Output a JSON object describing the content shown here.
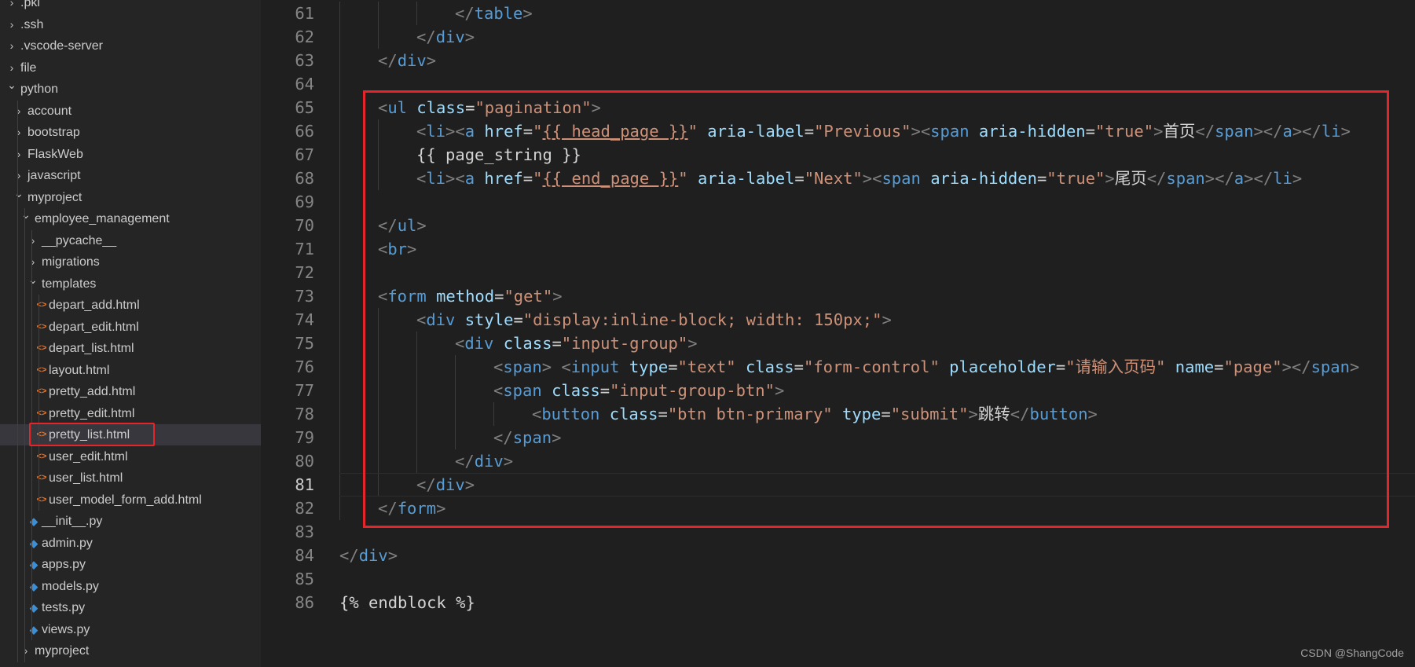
{
  "sidebar": {
    "items": [
      {
        "label": ".pki",
        "type": "folder",
        "state": "collapsed",
        "depth": 0
      },
      {
        "label": ".ssh",
        "type": "folder",
        "state": "collapsed",
        "depth": 0
      },
      {
        "label": ".vscode-server",
        "type": "folder",
        "state": "collapsed",
        "depth": 0
      },
      {
        "label": "file",
        "type": "folder",
        "state": "collapsed",
        "depth": 0
      },
      {
        "label": "python",
        "type": "folder",
        "state": "expanded",
        "depth": 0
      },
      {
        "label": "account",
        "type": "folder",
        "state": "collapsed",
        "depth": 1
      },
      {
        "label": "bootstrap",
        "type": "folder",
        "state": "collapsed",
        "depth": 1
      },
      {
        "label": "FlaskWeb",
        "type": "folder",
        "state": "collapsed",
        "depth": 1
      },
      {
        "label": "javascript",
        "type": "folder",
        "state": "collapsed",
        "depth": 1
      },
      {
        "label": "myproject",
        "type": "folder",
        "state": "expanded",
        "depth": 1
      },
      {
        "label": "employee_management",
        "type": "folder",
        "state": "expanded",
        "depth": 2
      },
      {
        "label": "__pycache__",
        "type": "folder",
        "state": "collapsed",
        "depth": 3
      },
      {
        "label": "migrations",
        "type": "folder",
        "state": "collapsed",
        "depth": 3
      },
      {
        "label": "templates",
        "type": "folder",
        "state": "expanded",
        "depth": 3
      },
      {
        "label": "depart_add.html",
        "type": "html",
        "depth": 4
      },
      {
        "label": "depart_edit.html",
        "type": "html",
        "depth": 4
      },
      {
        "label": "depart_list.html",
        "type": "html",
        "depth": 4
      },
      {
        "label": "layout.html",
        "type": "html",
        "depth": 4
      },
      {
        "label": "pretty_add.html",
        "type": "html",
        "depth": 4
      },
      {
        "label": "pretty_edit.html",
        "type": "html",
        "depth": 4
      },
      {
        "label": "pretty_list.html",
        "type": "html",
        "depth": 4,
        "selected": true
      },
      {
        "label": "user_edit.html",
        "type": "html",
        "depth": 4
      },
      {
        "label": "user_list.html",
        "type": "html",
        "depth": 4
      },
      {
        "label": "user_model_form_add.html",
        "type": "html",
        "depth": 4
      },
      {
        "label": "__init__.py",
        "type": "py",
        "depth": 3
      },
      {
        "label": "admin.py",
        "type": "py",
        "depth": 3
      },
      {
        "label": "apps.py",
        "type": "py",
        "depth": 3
      },
      {
        "label": "models.py",
        "type": "py",
        "depth": 3
      },
      {
        "label": "tests.py",
        "type": "py",
        "depth": 3
      },
      {
        "label": "views.py",
        "type": "py",
        "depth": 3
      },
      {
        "label": "myproject",
        "type": "folder",
        "state": "collapsed",
        "depth": 2
      }
    ]
  },
  "editor": {
    "active_line": "81",
    "lines": [
      {
        "n": "61",
        "indent": 3,
        "tokens": [
          [
            "bk",
            "</"
          ],
          [
            "t",
            "table"
          ],
          [
            "bk",
            ">"
          ]
        ]
      },
      {
        "n": "62",
        "indent": 2,
        "tokens": [
          [
            "bk",
            "</"
          ],
          [
            "t",
            "div"
          ],
          [
            "bk",
            ">"
          ]
        ]
      },
      {
        "n": "63",
        "indent": 1,
        "tokens": [
          [
            "bk",
            "</"
          ],
          [
            "t",
            "div"
          ],
          [
            "bk",
            ">"
          ]
        ]
      },
      {
        "n": "64",
        "indent": 0,
        "tokens": []
      },
      {
        "n": "65",
        "indent": 1,
        "tokens": [
          [
            "bk",
            "<"
          ],
          [
            "t",
            "ul"
          ],
          [
            "tx",
            " "
          ],
          [
            "at",
            "class"
          ],
          [
            "tx",
            "="
          ],
          [
            "st",
            "\"pagination\""
          ],
          [
            "bk",
            ">"
          ]
        ]
      },
      {
        "n": "66",
        "indent": 2,
        "tokens": [
          [
            "bk",
            "<"
          ],
          [
            "t",
            "li"
          ],
          [
            "bk",
            "><"
          ],
          [
            "t",
            "a"
          ],
          [
            "tx",
            " "
          ],
          [
            "at",
            "href"
          ],
          [
            "tx",
            "="
          ],
          [
            "st",
            "\""
          ],
          [
            "st ul",
            "{{ head_page }}"
          ],
          [
            "st",
            "\""
          ],
          [
            "tx",
            " "
          ],
          [
            "at",
            "aria-label"
          ],
          [
            "tx",
            "="
          ],
          [
            "st",
            "\"Previous\""
          ],
          [
            "bk",
            "><"
          ],
          [
            "t",
            "span"
          ],
          [
            "tx",
            " "
          ],
          [
            "at",
            "aria-hidden"
          ],
          [
            "tx",
            "="
          ],
          [
            "st",
            "\"true\""
          ],
          [
            "bk",
            ">"
          ],
          [
            "tx",
            "首页"
          ],
          [
            "bk",
            "</"
          ],
          [
            "t",
            "span"
          ],
          [
            "bk",
            "></"
          ],
          [
            "t",
            "a"
          ],
          [
            "bk",
            "></"
          ],
          [
            "t",
            "li"
          ],
          [
            "bk",
            ">"
          ]
        ]
      },
      {
        "n": "67",
        "indent": 2,
        "tokens": [
          [
            "tx",
            "{{ page_string }}"
          ]
        ]
      },
      {
        "n": "68",
        "indent": 2,
        "tokens": [
          [
            "bk",
            "<"
          ],
          [
            "t",
            "li"
          ],
          [
            "bk",
            "><"
          ],
          [
            "t",
            "a"
          ],
          [
            "tx",
            " "
          ],
          [
            "at",
            "href"
          ],
          [
            "tx",
            "="
          ],
          [
            "st",
            "\""
          ],
          [
            "st ul",
            "{{ end_page }}"
          ],
          [
            "st",
            "\""
          ],
          [
            "tx",
            " "
          ],
          [
            "at",
            "aria-label"
          ],
          [
            "tx",
            "="
          ],
          [
            "st",
            "\"Next\""
          ],
          [
            "bk",
            "><"
          ],
          [
            "t",
            "span"
          ],
          [
            "tx",
            " "
          ],
          [
            "at",
            "aria-hidden"
          ],
          [
            "tx",
            "="
          ],
          [
            "st",
            "\"true\""
          ],
          [
            "bk",
            ">"
          ],
          [
            "tx",
            "尾页"
          ],
          [
            "bk",
            "</"
          ],
          [
            "t",
            "span"
          ],
          [
            "bk",
            "></"
          ],
          [
            "t",
            "a"
          ],
          [
            "bk",
            "></"
          ],
          [
            "t",
            "li"
          ],
          [
            "bk",
            ">"
          ]
        ]
      },
      {
        "n": "69",
        "indent": 0,
        "tokens": []
      },
      {
        "n": "70",
        "indent": 1,
        "tokens": [
          [
            "bk",
            "</"
          ],
          [
            "t",
            "ul"
          ],
          [
            "bk",
            ">"
          ]
        ]
      },
      {
        "n": "71",
        "indent": 1,
        "tokens": [
          [
            "bk",
            "<"
          ],
          [
            "t",
            "br"
          ],
          [
            "bk",
            ">"
          ]
        ]
      },
      {
        "n": "72",
        "indent": 0,
        "tokens": []
      },
      {
        "n": "73",
        "indent": 1,
        "tokens": [
          [
            "bk",
            "<"
          ],
          [
            "t",
            "form"
          ],
          [
            "tx",
            " "
          ],
          [
            "at",
            "method"
          ],
          [
            "tx",
            "="
          ],
          [
            "st",
            "\"get\""
          ],
          [
            "bk",
            ">"
          ]
        ]
      },
      {
        "n": "74",
        "indent": 2,
        "tokens": [
          [
            "bk",
            "<"
          ],
          [
            "t",
            "div"
          ],
          [
            "tx",
            " "
          ],
          [
            "at",
            "style"
          ],
          [
            "tx",
            "="
          ],
          [
            "st",
            "\"display:inline-block; width: 150px;\""
          ],
          [
            "bk",
            ">"
          ]
        ]
      },
      {
        "n": "75",
        "indent": 3,
        "tokens": [
          [
            "bk",
            "<"
          ],
          [
            "t",
            "div"
          ],
          [
            "tx",
            " "
          ],
          [
            "at",
            "class"
          ],
          [
            "tx",
            "="
          ],
          [
            "st",
            "\"input-group\""
          ],
          [
            "bk",
            ">"
          ]
        ]
      },
      {
        "n": "76",
        "indent": 4,
        "tokens": [
          [
            "bk",
            "<"
          ],
          [
            "t",
            "span"
          ],
          [
            "bk",
            ">"
          ],
          [
            "tx",
            " "
          ],
          [
            "bk",
            "<"
          ],
          [
            "t",
            "input"
          ],
          [
            "tx",
            " "
          ],
          [
            "at",
            "type"
          ],
          [
            "tx",
            "="
          ],
          [
            "st",
            "\"text\""
          ],
          [
            "tx",
            " "
          ],
          [
            "at",
            "class"
          ],
          [
            "tx",
            "="
          ],
          [
            "st",
            "\"form-control\""
          ],
          [
            "tx",
            " "
          ],
          [
            "at",
            "placeholder"
          ],
          [
            "tx",
            "="
          ],
          [
            "st",
            "\"请输入页码\""
          ],
          [
            "tx",
            " "
          ],
          [
            "at",
            "name"
          ],
          [
            "tx",
            "="
          ],
          [
            "st",
            "\"page\""
          ],
          [
            "bk",
            "></"
          ],
          [
            "t",
            "span"
          ],
          [
            "bk",
            ">"
          ]
        ]
      },
      {
        "n": "77",
        "indent": 4,
        "tokens": [
          [
            "bk",
            "<"
          ],
          [
            "t",
            "span"
          ],
          [
            "tx",
            " "
          ],
          [
            "at",
            "class"
          ],
          [
            "tx",
            "="
          ],
          [
            "st",
            "\"input-group-btn\""
          ],
          [
            "bk",
            ">"
          ]
        ]
      },
      {
        "n": "78",
        "indent": 5,
        "tokens": [
          [
            "bk",
            "<"
          ],
          [
            "t",
            "button"
          ],
          [
            "tx",
            " "
          ],
          [
            "at",
            "class"
          ],
          [
            "tx",
            "="
          ],
          [
            "st",
            "\"btn btn-primary\""
          ],
          [
            "tx",
            " "
          ],
          [
            "at",
            "type"
          ],
          [
            "tx",
            "="
          ],
          [
            "st",
            "\"submit\""
          ],
          [
            "bk",
            ">"
          ],
          [
            "tx",
            "跳转"
          ],
          [
            "bk",
            "</"
          ],
          [
            "t",
            "button"
          ],
          [
            "bk",
            ">"
          ]
        ]
      },
      {
        "n": "79",
        "indent": 4,
        "tokens": [
          [
            "bk",
            "</"
          ],
          [
            "t",
            "span"
          ],
          [
            "bk",
            ">"
          ]
        ]
      },
      {
        "n": "80",
        "indent": 3,
        "tokens": [
          [
            "bk",
            "</"
          ],
          [
            "t",
            "div"
          ],
          [
            "bk",
            ">"
          ]
        ]
      },
      {
        "n": "81",
        "indent": 2,
        "tokens": [
          [
            "bk",
            "</"
          ],
          [
            "t",
            "div"
          ],
          [
            "bk",
            ">"
          ]
        ]
      },
      {
        "n": "82",
        "indent": 1,
        "tokens": [
          [
            "bk",
            "</"
          ],
          [
            "t",
            "form"
          ],
          [
            "bk",
            ">"
          ]
        ]
      },
      {
        "n": "83",
        "indent": 0,
        "tokens": []
      },
      {
        "n": "84",
        "indent": 0,
        "tokens": [
          [
            "bk",
            "</"
          ],
          [
            "t",
            "div"
          ],
          [
            "bk",
            ">"
          ]
        ]
      },
      {
        "n": "85",
        "indent": 0,
        "tokens": []
      },
      {
        "n": "86",
        "indent": 0,
        "tokens": [
          [
            "tx",
            "{% endblock %}"
          ]
        ]
      }
    ]
  },
  "watermark": "CSDN @ShangCode",
  "colors": {
    "tag": "#569cd6",
    "bracket": "#808080",
    "attribute": "#9cdcfe",
    "string": "#ce9178",
    "text": "#d4d4d4",
    "highlight_box": "#e5252a",
    "html_icon": "#e37933",
    "python_icon": "#3a8fd6"
  }
}
